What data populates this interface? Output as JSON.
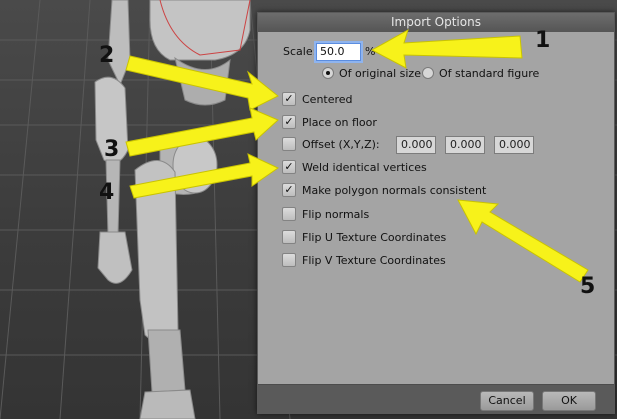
{
  "dialog": {
    "title": "Import Options",
    "scale_label": "Scale:",
    "scale_value": "50.0",
    "scale_unit": "%",
    "radio_original": "Of original size",
    "radio_standard": "Of standard figure",
    "radio_selected": "original",
    "options": [
      {
        "label": "Centered",
        "checked": true
      },
      {
        "label": "Place on floor",
        "checked": true
      },
      {
        "label": "Offset (X,Y,Z):",
        "checked": false
      },
      {
        "label": "Weld identical vertices",
        "checked": true
      },
      {
        "label": "Make polygon normals consistent",
        "checked": true
      },
      {
        "label": "Flip normals",
        "checked": false
      },
      {
        "label": "Flip U Texture Coordinates",
        "checked": false
      },
      {
        "label": "Flip V Texture Coordinates",
        "checked": false
      }
    ],
    "offset_values": [
      "0.000",
      "0.000",
      "0.000"
    ],
    "cancel_label": "Cancel",
    "ok_label": "OK"
  },
  "annotations": [
    "1",
    "2",
    "3",
    "4",
    "5"
  ],
  "colors": {
    "arrow": "#f7f21a",
    "dialog_bg": "#a4a4a4",
    "viewport_bg": "#3c3c3c"
  }
}
